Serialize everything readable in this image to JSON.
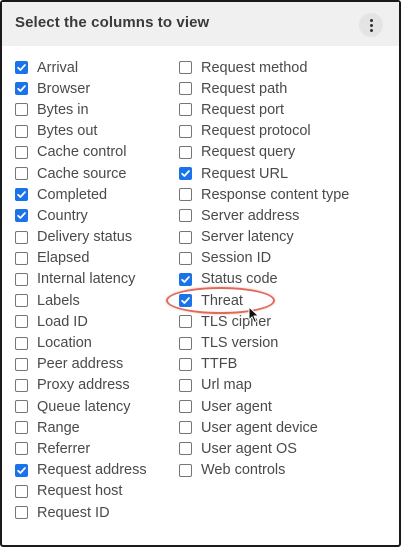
{
  "panel": {
    "title": "Select the columns to view",
    "menu_icon": "kebab-menu-icon"
  },
  "accent_color": "#1a73e8",
  "highlight_color": "#e06a5a",
  "left_column": [
    {
      "label": "Arrival",
      "checked": true
    },
    {
      "label": "Browser",
      "checked": true
    },
    {
      "label": "Bytes in",
      "checked": false
    },
    {
      "label": "Bytes out",
      "checked": false
    },
    {
      "label": "Cache control",
      "checked": false
    },
    {
      "label": "Cache source",
      "checked": false
    },
    {
      "label": "Completed",
      "checked": true
    },
    {
      "label": "Country",
      "checked": true
    },
    {
      "label": "Delivery status",
      "checked": false
    },
    {
      "label": "Elapsed",
      "checked": false
    },
    {
      "label": "Internal latency",
      "checked": false
    },
    {
      "label": "Labels",
      "checked": false
    },
    {
      "label": "Load ID",
      "checked": false
    },
    {
      "label": "Location",
      "checked": false
    },
    {
      "label": "Peer address",
      "checked": false
    },
    {
      "label": "Proxy address",
      "checked": false
    },
    {
      "label": "Queue latency",
      "checked": false
    },
    {
      "label": "Range",
      "checked": false
    },
    {
      "label": "Referrer",
      "checked": false
    },
    {
      "label": "Request address",
      "checked": true
    },
    {
      "label": "Request host",
      "checked": false
    },
    {
      "label": "Request ID",
      "checked": false
    }
  ],
  "right_column": [
    {
      "label": "Request method",
      "checked": false
    },
    {
      "label": "Request path",
      "checked": false
    },
    {
      "label": "Request port",
      "checked": false
    },
    {
      "label": "Request protocol",
      "checked": false
    },
    {
      "label": "Request query",
      "checked": false
    },
    {
      "label": "Request URL",
      "checked": true
    },
    {
      "label": "Response content type",
      "checked": false
    },
    {
      "label": "Server address",
      "checked": false
    },
    {
      "label": "Server latency",
      "checked": false
    },
    {
      "label": "Session ID",
      "checked": false
    },
    {
      "label": "Status code",
      "checked": true
    },
    {
      "label": "Threat",
      "checked": true
    },
    {
      "label": "TLS cipher",
      "checked": false
    },
    {
      "label": "TLS version",
      "checked": false
    },
    {
      "label": "TTFB",
      "checked": false
    },
    {
      "label": "Url map",
      "checked": false
    },
    {
      "label": "User agent",
      "checked": false
    },
    {
      "label": "User agent device",
      "checked": false
    },
    {
      "label": "User agent OS",
      "checked": false
    },
    {
      "label": "Web controls",
      "checked": false
    }
  ],
  "highlighted_option": "Threat"
}
